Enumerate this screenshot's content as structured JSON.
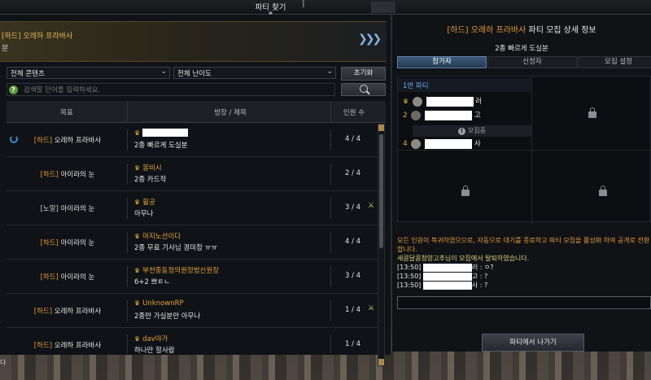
{
  "window": {
    "title": "파티 찾기"
  },
  "banner": {
    "title": "[하드] 오레하 프라바사",
    "subtitle": "분"
  },
  "filters": {
    "content": "전체 콘텐츠",
    "difficulty": "전체 난이도",
    "reset_label": "초기화"
  },
  "search": {
    "placeholder": "검색할 단어를 입력하세요."
  },
  "table": {
    "headers": {
      "goal": "목표",
      "leader_title": "방장 / 제목",
      "count": "인원 수"
    },
    "rows": [
      {
        "difficulty": "[하드]",
        "goal": "오레하 프라바사",
        "leader": "",
        "title": "2종 빠르게 도실분",
        "count": "4 / 4",
        "hard": true,
        "loading": true,
        "sword": false,
        "redacted": true
      },
      {
        "difficulty": "[하드]",
        "goal": "아이라의 눈",
        "leader": "몽비시",
        "title": "2종 카드작",
        "count": "2 / 4",
        "hard": true,
        "loading": false,
        "sword": false,
        "redacted": false
      },
      {
        "difficulty": "[노말]",
        "goal": "아이라의 눈",
        "leader": "휠궁",
        "title": "아무나",
        "count": "3 / 4",
        "hard": false,
        "loading": false,
        "sword": true,
        "redacted": false
      },
      {
        "difficulty": "[하드]",
        "goal": "아이라의 눈",
        "leader": "마지노선이다",
        "title": "2종 무료 기사님 경미참 ㅠㅠ",
        "count": "4 / 4",
        "hard": true,
        "loading": false,
        "sword": false,
        "redacted": false
      },
      {
        "difficulty": "[하드]",
        "goal": "아이라의 눈",
        "leader": "부천중동정의원정범신원장",
        "title": "6+2 쁘ㅌㄴ",
        "count": "3 / 4",
        "hard": true,
        "loading": false,
        "sword": false,
        "redacted": false
      },
      {
        "difficulty": "[하드]",
        "goal": "오레하 프라바사",
        "leader": "UnknownRP",
        "title": "2종만 가실분만 아무나",
        "count": "1 / 4",
        "hard": true,
        "loading": false,
        "sword": true,
        "redacted": false
      },
      {
        "difficulty": "[하드]",
        "goal": "오레하 프라바사",
        "leader": "dav야가",
        "title": "하나만 할사람",
        "count": "1 / 4",
        "hard": true,
        "loading": false,
        "sword": false,
        "redacted": false
      }
    ]
  },
  "detail": {
    "title_hard": "[하드] 오레하 프라바사",
    "title_rest": "파티 모집 상세 정보",
    "party_title": "2종 빠르게 도실분",
    "tabs": [
      "참가자",
      "신청자",
      "모집 설정"
    ],
    "party_label": "1번 파티",
    "members": [
      {
        "index": "",
        "suffix": "러",
        "crown": true
      },
      {
        "index": "2",
        "suffix": "고",
        "crown": false
      },
      {
        "index": "4",
        "suffix": "사",
        "crown": false
      }
    ],
    "recruiting_label": "모집중",
    "chat": {
      "system": "모든 인원이 복귀하였으므로, 자동으로 대기를 종료하고 파티 모집을 활성화 하여 공개로 전환합니다.",
      "leave_notice": "새콤달콤청양고추님이 모집에서 탈퇴하였습니다.",
      "lines": [
        {
          "time": "[13:50]",
          "suffix": "러 : ㅇ?"
        },
        {
          "time": "[13:50]",
          "suffix": "고 : ?"
        },
        {
          "time": "[13:50]",
          "suffix": "사 : ?"
        }
      ]
    },
    "leave_button": "파티에서 나가기"
  },
  "colors": {
    "accent_hard": "#e49a3a",
    "accent_blue": "#6fa8e6",
    "crown": "#e3b53a"
  }
}
